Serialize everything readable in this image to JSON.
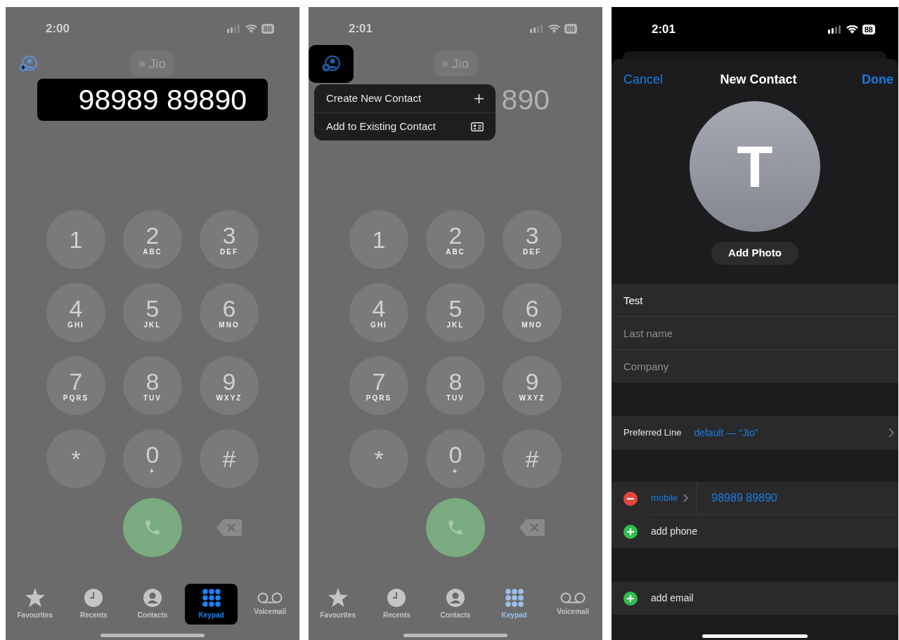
{
  "screens": [
    {
      "kind": "keypad",
      "status_bar": {
        "time": "2:00",
        "battery": "88"
      },
      "add_contact_highlighted": false,
      "carrier": "Jio",
      "number": "98989 89890",
      "number_highlighted": true,
      "keys": [
        {
          "digit": "1"
        },
        {
          "digit": "2",
          "letters": "ABC"
        },
        {
          "digit": "3",
          "letters": "DEF"
        },
        {
          "digit": "4",
          "letters": "GHI"
        },
        {
          "digit": "5",
          "letters": "JKL"
        },
        {
          "digit": "6",
          "letters": "MNO"
        },
        {
          "digit": "7",
          "letters": "PQRS"
        },
        {
          "digit": "8",
          "letters": "TUV"
        },
        {
          "digit": "9",
          "letters": "WXYZ"
        },
        {
          "digit": "*"
        },
        {
          "digit": "0",
          "letters": "+"
        },
        {
          "digit": "#"
        }
      ],
      "tabs": [
        {
          "kind": "star",
          "label": "Favourites",
          "selected": false,
          "highlighted": false
        },
        {
          "kind": "clock",
          "label": "Recents",
          "selected": false,
          "highlighted": false
        },
        {
          "kind": "person",
          "label": "Contacts",
          "selected": false,
          "highlighted": false
        },
        {
          "kind": "keypad",
          "label": "Keypad",
          "selected": true,
          "highlighted": true
        },
        {
          "kind": "voicemail",
          "label": "Voicemail",
          "selected": false,
          "highlighted": false
        }
      ]
    },
    {
      "kind": "keypad",
      "status_bar": {
        "time": "2:01",
        "battery": "88"
      },
      "add_contact_highlighted": true,
      "carrier": "Jio",
      "number": "890",
      "number_highlighted": false,
      "menu": [
        {
          "kind": "plus",
          "label": "Create New Contact"
        },
        {
          "kind": "card",
          "label": "Add to Existing Contact"
        }
      ],
      "keys": [
        {
          "digit": "1"
        },
        {
          "digit": "2",
          "letters": "ABC"
        },
        {
          "digit": "3",
          "letters": "DEF"
        },
        {
          "digit": "4",
          "letters": "GHI"
        },
        {
          "digit": "5",
          "letters": "JKL"
        },
        {
          "digit": "6",
          "letters": "MNO"
        },
        {
          "digit": "7",
          "letters": "PQRS"
        },
        {
          "digit": "8",
          "letters": "TUV"
        },
        {
          "digit": "9",
          "letters": "WXYZ"
        },
        {
          "digit": "*"
        },
        {
          "digit": "0",
          "letters": "+"
        },
        {
          "digit": "#"
        }
      ],
      "tabs": [
        {
          "kind": "star",
          "label": "Favourites",
          "selected": false,
          "highlighted": false
        },
        {
          "kind": "clock",
          "label": "Recents",
          "selected": false,
          "highlighted": false
        },
        {
          "kind": "person",
          "label": "Contacts",
          "selected": false,
          "highlighted": false
        },
        {
          "kind": "keypad",
          "label": "Keypad",
          "selected": true,
          "highlighted": false
        },
        {
          "kind": "voicemail",
          "label": "Voicemail",
          "selected": false,
          "highlighted": false
        }
      ]
    },
    {
      "kind": "new_contact",
      "status_bar": {
        "time": "2:01",
        "battery": "88"
      },
      "nav": {
        "cancel": "Cancel",
        "title": "New Contact",
        "done": "Done"
      },
      "avatar_letter": "T",
      "add_photo": "Add Photo",
      "name_fields": [
        {
          "value": "Test"
        },
        {
          "placeholder": "Last name"
        },
        {
          "placeholder": "Company"
        }
      ],
      "preferred_line": {
        "label": "Preferred Line",
        "value": "default — “Jio”"
      },
      "phones": [
        {
          "kind": "phone",
          "label": "mobile",
          "value": "98989 89890"
        },
        {
          "kind": "add",
          "label": "add phone"
        }
      ],
      "emails": [
        {
          "kind": "add",
          "label": "add email"
        }
      ]
    }
  ]
}
